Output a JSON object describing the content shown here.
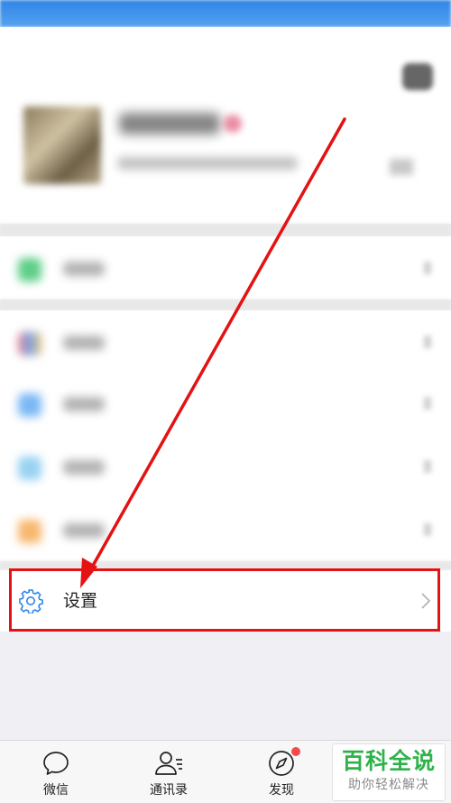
{
  "settings": {
    "label": "设置"
  },
  "tabbar": {
    "tabs": [
      {
        "label": "微信"
      },
      {
        "label": "通讯录"
      },
      {
        "label": "发现"
      }
    ]
  },
  "watermark": {
    "title": "百科全说",
    "subtitle": "助你轻松解决"
  },
  "colors": {
    "highlight": "#e41212",
    "accent": "#2f86e6",
    "watermark_green": "#2fb24a",
    "badge": "#f14b4b"
  }
}
